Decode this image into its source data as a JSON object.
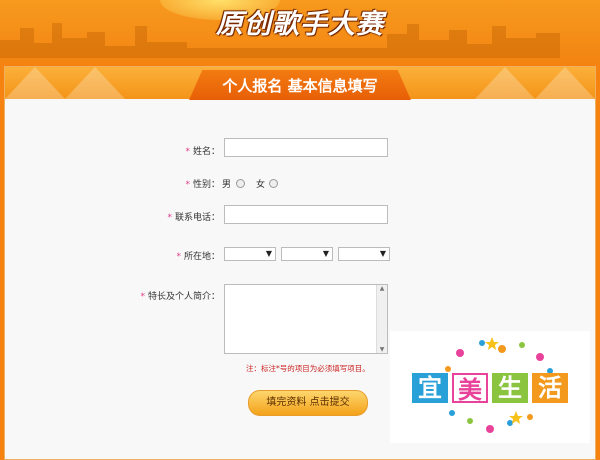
{
  "banner": {
    "title": "原创歌手大赛"
  },
  "panel": {
    "header": "个人报名 基本信息填写"
  },
  "form": {
    "name_label": "姓名：",
    "gender_label": "性别：",
    "gender_male": "男",
    "gender_female": "女",
    "phone_label": "联系电话：",
    "location_label": "所在地：",
    "intro_label": "特长及个人简介：",
    "required_mark": "*",
    "note": "注：标注*号的项目为必须填写项目。",
    "submit_label": "填完资料 点击提交"
  },
  "watermark": {
    "chars": [
      "宜",
      "美",
      "生",
      "活"
    ],
    "colors": [
      "#2aa0d8",
      "#e8429b",
      "#8bc53f",
      "#f39a1e"
    ]
  }
}
